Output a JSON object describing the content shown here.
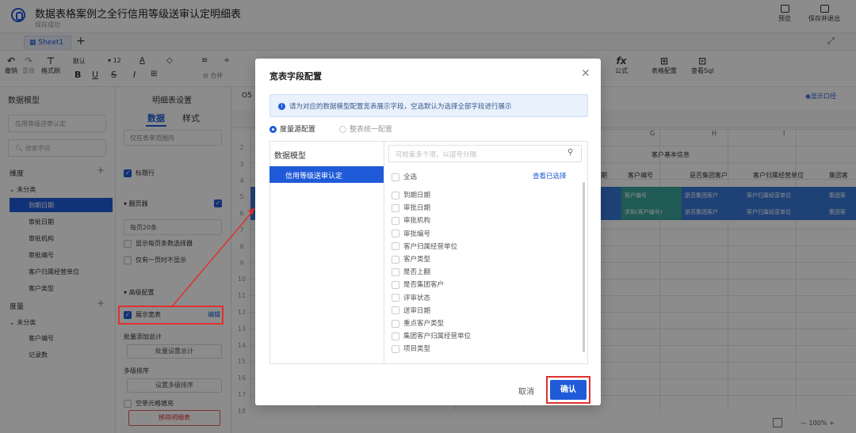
{
  "header": {
    "title": "数据表格案例之全行信用等级送审认定明细表",
    "status": "保存成功",
    "preview_label": "预览",
    "save_exit_label": "保存并退出"
  },
  "sheet_tabs": {
    "active": "Sheet1",
    "add_label": "+"
  },
  "toolbar": {
    "undo": "撤销",
    "redo": "重做",
    "format_painter": "格式刷",
    "font_default": "默认",
    "font_size": "12",
    "merge": "合并",
    "formula": "公式",
    "table_config": "表格配置",
    "view_sql": "查看Sql",
    "fx_label": "fx"
  },
  "left_panel": {
    "title": "数据模型",
    "model_select": "信用等级送审认定",
    "search_placeholder": "搜索字段",
    "dimension_label": "维度",
    "uncategorized_label": "未分类",
    "dimension_items": [
      "到期日期",
      "审批日期",
      "审批机构",
      "审批编号",
      "客户归属经营单位",
      "客户类型"
    ],
    "measure_label": "度量",
    "measure_uncategorized": "未分类",
    "measure_items": [
      "客户编号",
      "记录数"
    ]
  },
  "mid_panel": {
    "title": "明细表设置",
    "tab_data": "数据",
    "tab_style": "样式",
    "range": "仅在表单范围内",
    "title_row": "标题行",
    "pager": "翻页器",
    "per_page": "每页20条",
    "show_pagesize_selector": "显示每页条数选择器",
    "hide_when_one_page": "仅有一页时不显示",
    "advanced": "高级配置",
    "show_wide_table": "展示宽表",
    "edit": "编辑",
    "batch_total_label": "批量添加总计",
    "batch_total_btn": "批量设置总计",
    "multi_sort_label": "多级排序",
    "multi_sort_btn": "设置多级排序",
    "empty_cell_fill": "空单元格填充",
    "remove_detail": "移除明细表"
  },
  "sheet": {
    "cell_ref": "O5",
    "show_caliber": "显示口径",
    "col_letters": [
      "G",
      "H",
      "I"
    ],
    "row_numbers": [
      "2",
      "3",
      "4",
      "5",
      "6",
      "7",
      "8",
      "9",
      "10",
      "11",
      "12",
      "13",
      "14",
      "15",
      "16",
      "17",
      "18"
    ],
    "group_title": "客户基本信息",
    "headers": [
      "期",
      "客户编号",
      "是否集团客户",
      "客户归属经营单位",
      "集团客"
    ],
    "row5": [
      "客户编号",
      "是否集团客户",
      "客户归属经营单位",
      "集团客"
    ],
    "row6": [
      "求和(客户编号)",
      "是否集团客户",
      "客户归属经营单位",
      "集团客"
    ],
    "zoom": "100%"
  },
  "dialog": {
    "title": "宽表字段配置",
    "info": "请为对应的数据模型配置宽表展示字段，空选默认为选择全部字段进行展示",
    "radio_by_measure": "度量源配置",
    "radio_unified": "整表统一配置",
    "model_header": "数据模型",
    "model_item": "信用等级送审认定",
    "search_placeholder": "可检索多个项，以逗号分隔",
    "select_all": "全选",
    "view_selected": "查看已选择",
    "fields": [
      "到期日期",
      "审批日期",
      "审批机构",
      "审批编号",
      "客户归属经营单位",
      "客户类型",
      "是否上翻",
      "是否集团客户",
      "评审状态",
      "送审日期",
      "重点客户类型",
      "集团客户归属经营单位",
      "项目类型"
    ],
    "cancel": "取消",
    "confirm": "确认"
  },
  "colors": {
    "accent": "#1f5bd8",
    "highlight": "#e03030",
    "cell_blue": "#3a78d8",
    "cell_green": "#3aa79a"
  }
}
